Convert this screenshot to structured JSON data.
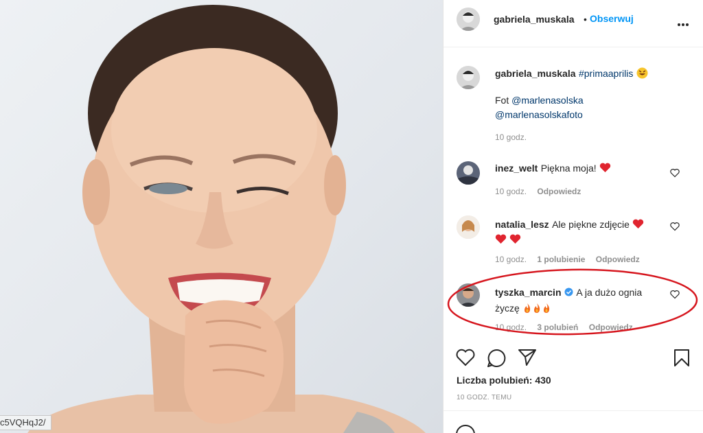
{
  "url_fragment": "c5VQHqJ2/",
  "post": {
    "author": "gabriela_muskala",
    "follow_label": "Obserwuj",
    "more_icon": "more-options-icon",
    "caption_tag": "#primaaprilis",
    "caption_credit_prefix": "Fot",
    "caption_credit_1": "@marlenasolska",
    "caption_credit_2": "@marlenasolskafoto",
    "caption_time": "10 godz."
  },
  "comments": [
    {
      "user": "inez_welt",
      "text": "Piękna moja!",
      "time": "10 godz.",
      "likes": "",
      "reply": "Odpowiedz"
    },
    {
      "user": "natalia_lesz",
      "text": "Ale piękne zdjęcie",
      "time": "10 godz.",
      "likes": "1 polubienie",
      "reply": "Odpowiedz"
    },
    {
      "user": "tyszka_marcin",
      "text_line1": "A ja dużo ognia",
      "text_line2": "życzę",
      "time": "10 godz.",
      "likes": "3 polubień",
      "reply": "Odpowiedz",
      "verified": true
    }
  ],
  "likes_label": "Liczba polubień: 430",
  "post_time": "10 GODZ. TEMU",
  "colors": {
    "follow_blue": "#0095f6",
    "heart_red": "#e0242f",
    "annotation_red": "#d6161e",
    "verified_blue": "#3897f0"
  }
}
